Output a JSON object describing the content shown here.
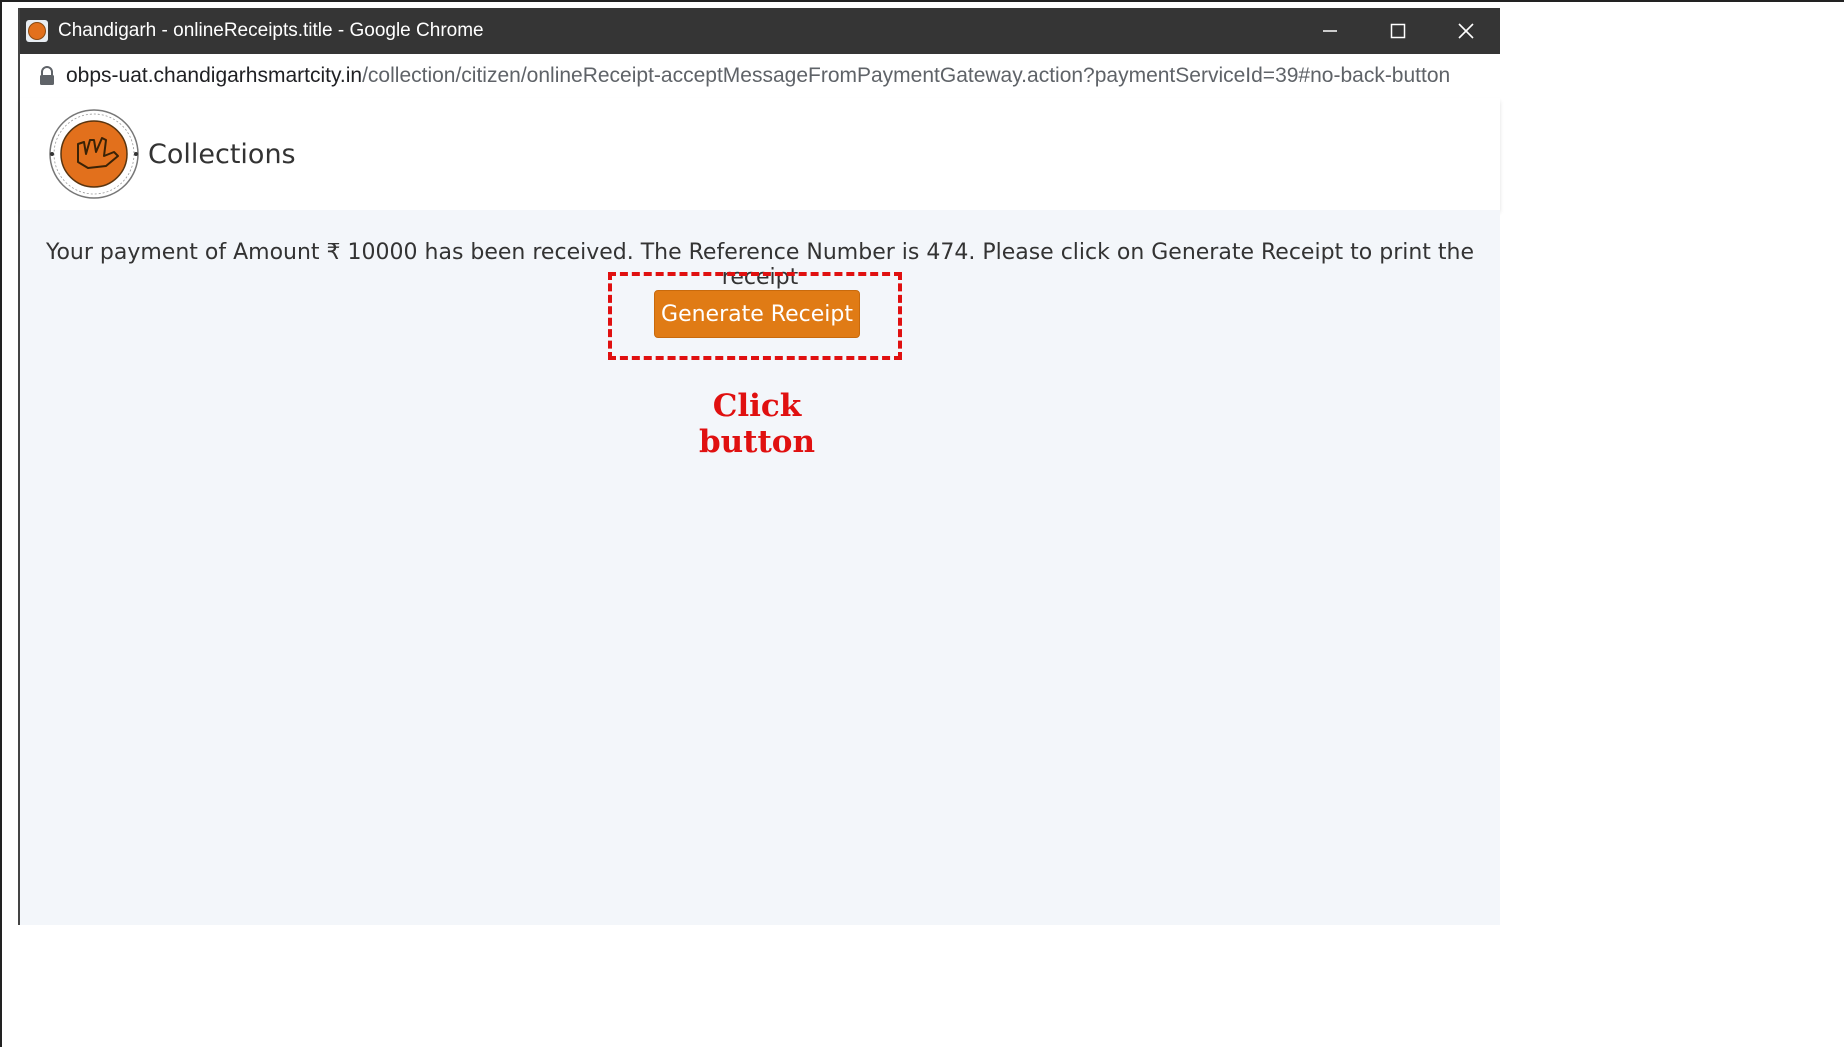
{
  "window": {
    "title": "Chandigarh - onlineReceipts.title - Google Chrome",
    "url_host": "obps-uat.chandigarhsmartcity.in",
    "url_path": "/collection/citizen/onlineReceipt-acceptMessageFromPaymentGateway.action?paymentServiceId=39#no-back-button"
  },
  "header": {
    "app_name": "Collections",
    "logo_icon": "chandigarh-administration-emblem"
  },
  "main": {
    "message": "Your payment of Amount ₹ 10000 has been received. The Reference Number is 474. Please click on Generate Receipt to print the receipt",
    "generate_button_label": "Generate Receipt"
  },
  "annotation": {
    "line1": "Click",
    "line2": "button",
    "color": "#e01010"
  },
  "colors": {
    "accent": "#e07b15",
    "titlebar": "#353535",
    "content_bg": "#f3f6fa"
  }
}
